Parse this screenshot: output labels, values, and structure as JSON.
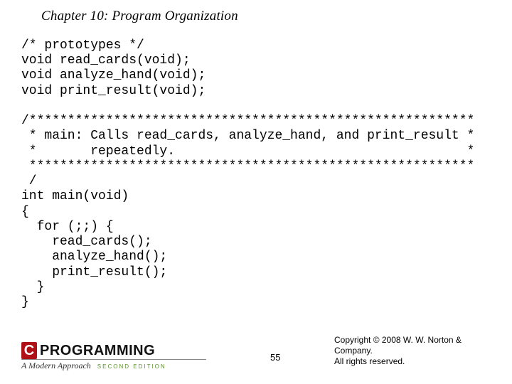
{
  "heading": "Chapter 10: Program Organization",
  "code": "/* prototypes */\nvoid read_cards(void);\nvoid analyze_hand(void);\nvoid print_result(void);\n\n/**********************************************************\n * main: Calls read_cards, analyze_hand, and print_result *\n *       repeatedly.                                      *\n **********************************************************\n /\nint main(void)\n{\n  for (;;) {\n    read_cards();\n    analyze_hand();\n    print_result();\n  }\n}",
  "logo": {
    "c": "C",
    "word": "PROGRAMMING",
    "sub": "A Modern Approach",
    "edition": "SECOND EDITION"
  },
  "page_number": "55",
  "copyright_line1": "Copyright © 2008 W. W. Norton & Company.",
  "copyright_line2": "All rights reserved."
}
